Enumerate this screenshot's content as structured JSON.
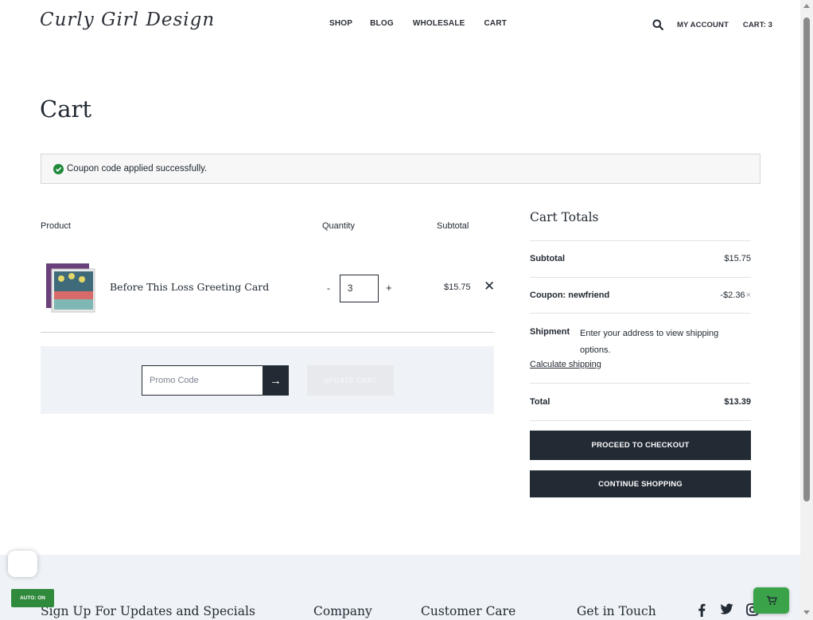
{
  "header": {
    "logo": "Curly Girl Design",
    "nav": [
      "SHOP",
      "BLOG",
      "WHOLESALE",
      "CART"
    ],
    "account_label": "MY ACCOUNT",
    "cart_label": "CART: 3"
  },
  "page": {
    "title": "Cart",
    "notice": "Coupon code applied successfully."
  },
  "cart_table": {
    "columns": [
      "Product",
      "Quantity",
      "Subtotal"
    ],
    "items": [
      {
        "name": "Before This Loss Greeting Card",
        "quantity": "3",
        "subtotal": "$15.75"
      }
    ],
    "minus": "-",
    "plus": "+",
    "remove": "✕"
  },
  "promo": {
    "placeholder": "Promo Code",
    "arrow": "→",
    "update_label": "UPDATE CART"
  },
  "totals": {
    "title": "Cart Totals",
    "subtotal_label": "Subtotal",
    "subtotal_value": "$15.75",
    "coupon_label": "Coupon: newfriend",
    "coupon_value": "-$2.36",
    "coupon_remove": "×",
    "shipment_label": "Shipment",
    "shipment_text": "Enter your address to view shipping options.",
    "calc_shipping": "Calculate shipping",
    "total_label": "Total",
    "total_value": "$13.39",
    "checkout_label": "PROCEED TO CHECKOUT",
    "continue_label": "CONTINUE SHOPPING"
  },
  "footer": {
    "signup": "Sign Up For Updates and Specials",
    "company": "Company",
    "customer_care": "Customer Care",
    "contact": "Get in Touch",
    "social": [
      "facebook-icon",
      "twitter-icon",
      "instagram-icon"
    ]
  },
  "widgets": {
    "auto_badge": "AUTO: ON"
  },
  "colors": {
    "dark": "#222a33",
    "success": "#1e8a3a",
    "panel": "#eff3f7",
    "cart_fab": "#3aa349"
  }
}
